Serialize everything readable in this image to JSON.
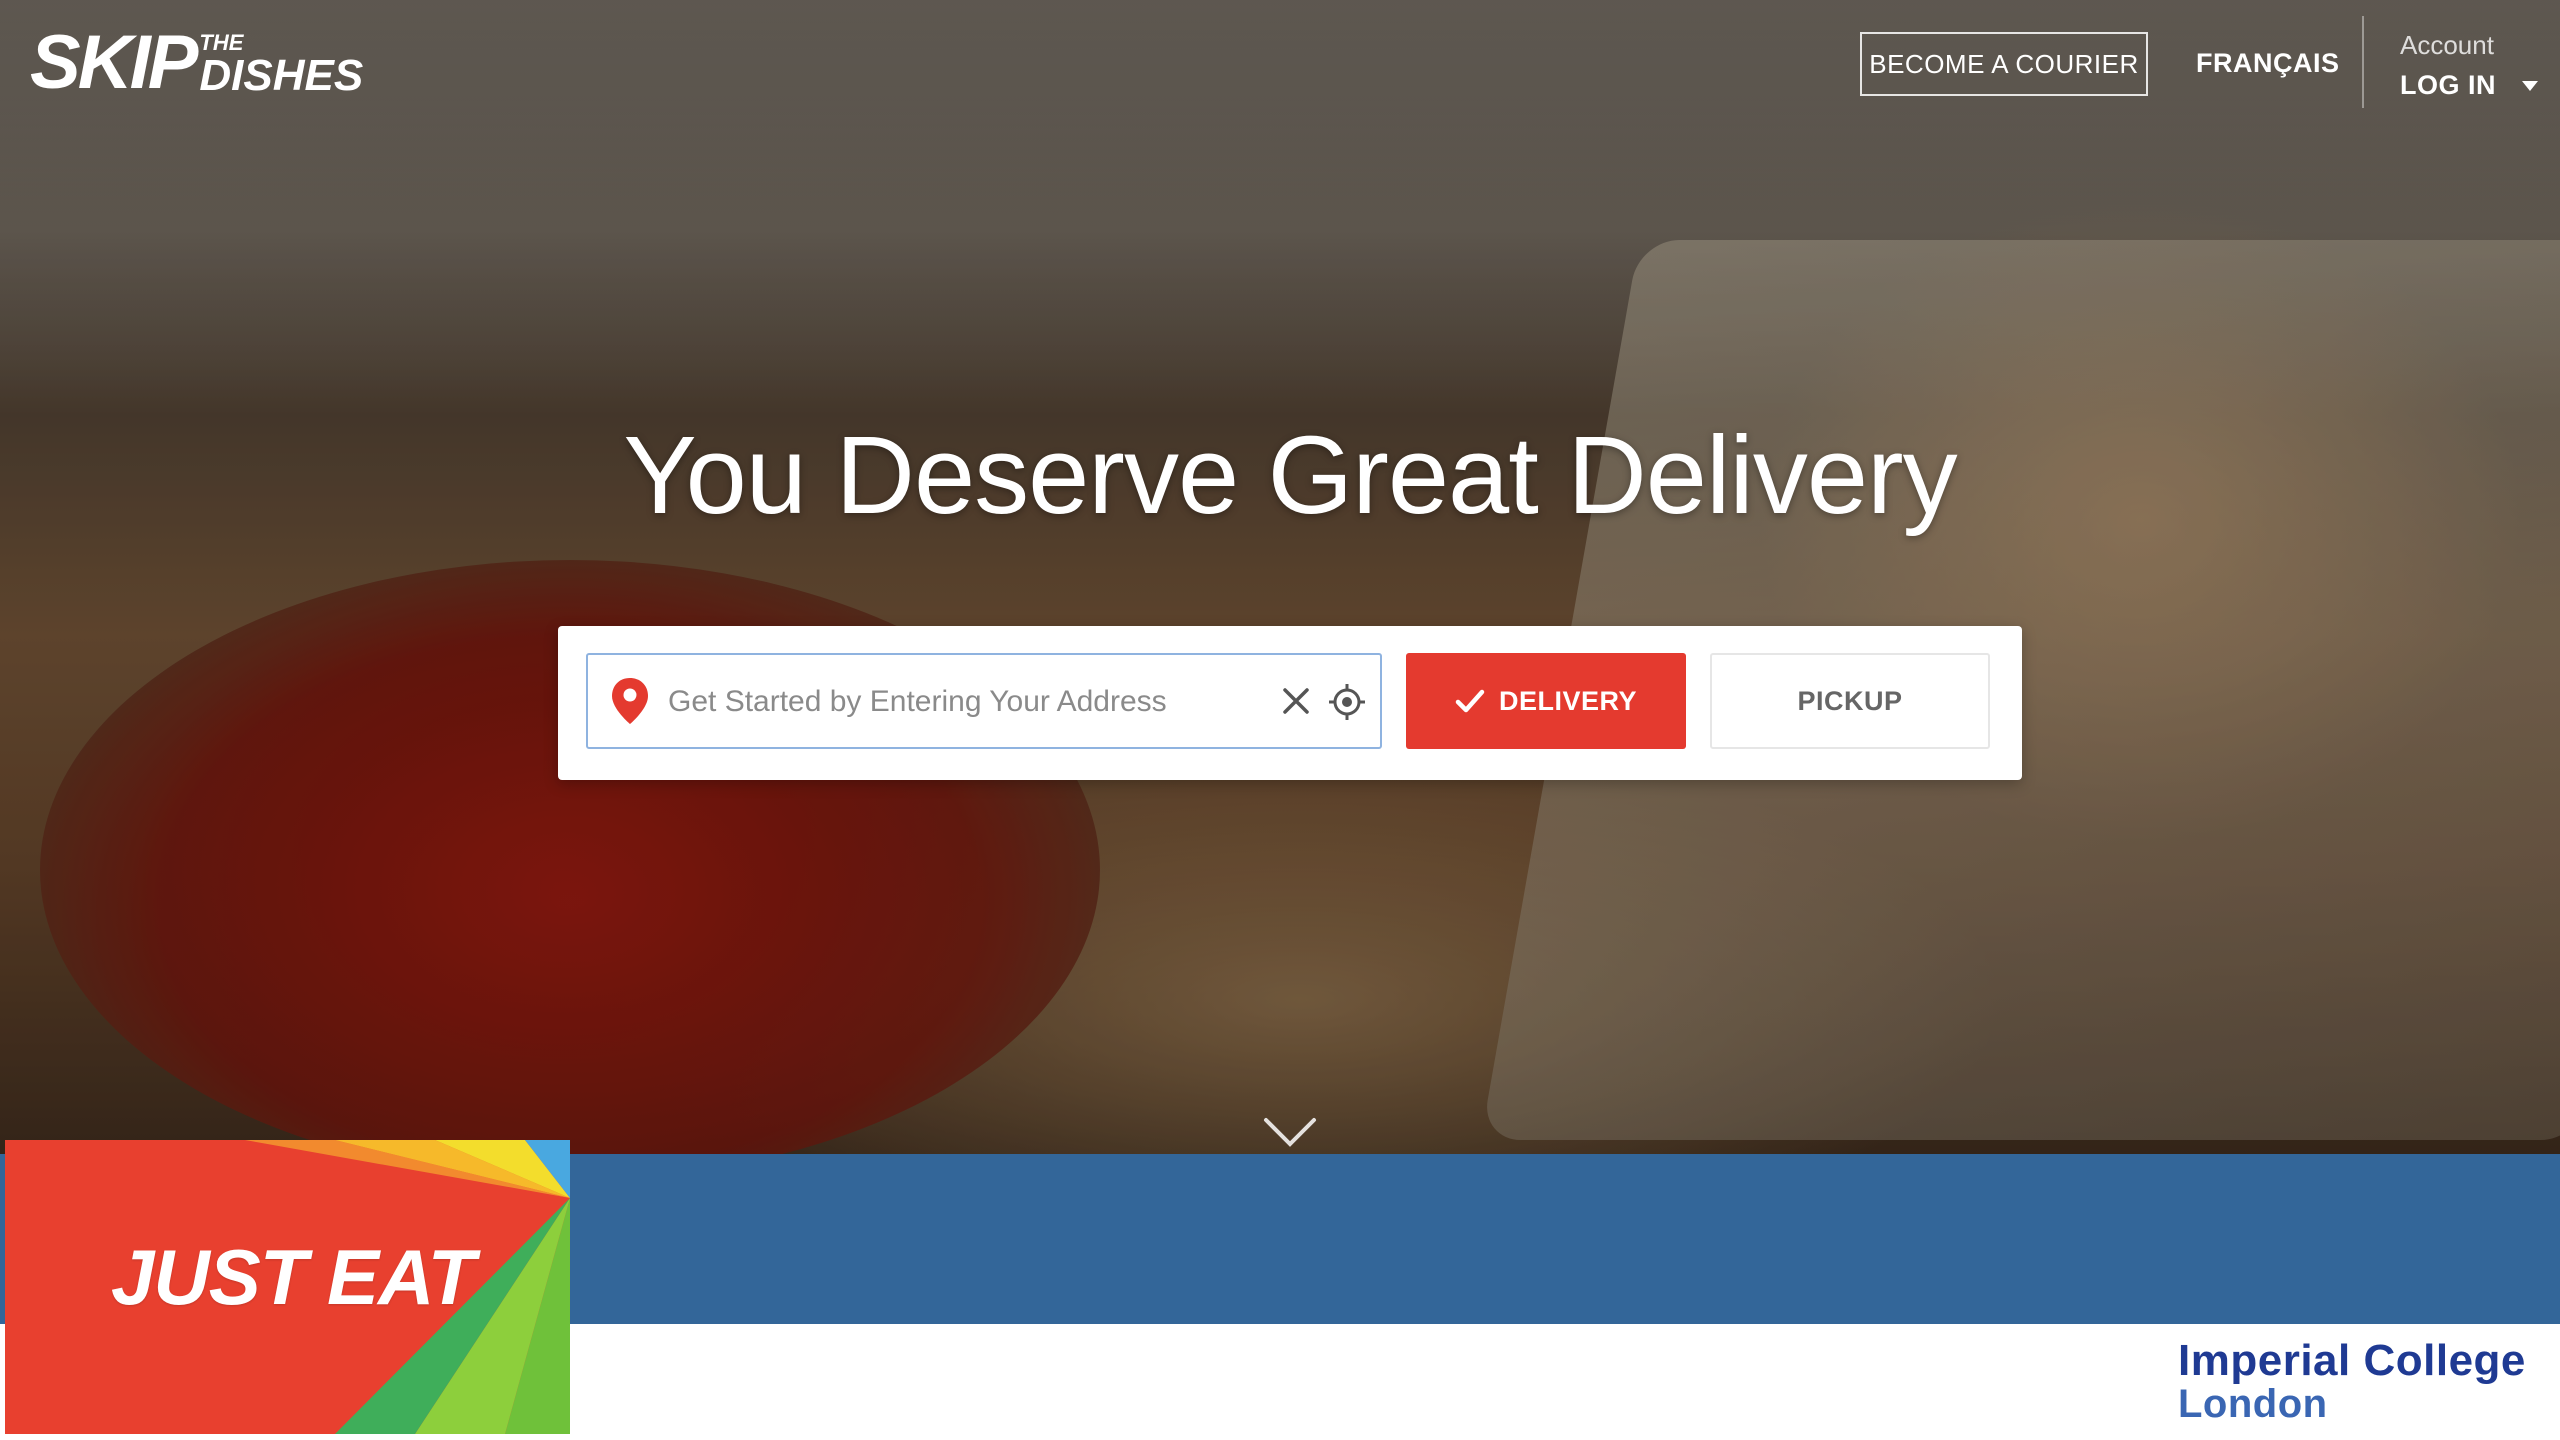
{
  "brand": {
    "logo_main": "SKIP",
    "logo_small": "THE",
    "logo_secondary": "DISHES"
  },
  "nav": {
    "courier_label": "BECOME A COURIER",
    "language_label": "FRANÇAIS",
    "account_label": "Account",
    "login_label": "LOG IN"
  },
  "hero": {
    "headline": "You Deserve Great Delivery"
  },
  "search": {
    "placeholder": "Get Started by Entering Your Address",
    "value": "",
    "delivery_label": "DELIVERY",
    "pickup_label": "PICKUP",
    "selected_mode": "delivery"
  },
  "colors": {
    "accent_red": "#e43a2f",
    "footer_blue": "#336699",
    "imperial_navy": "#1f3a93"
  },
  "slide_footer": {
    "just_eat_logo": "JUST EAT",
    "institution_line1": "Imperial College",
    "institution_line2": "London"
  }
}
